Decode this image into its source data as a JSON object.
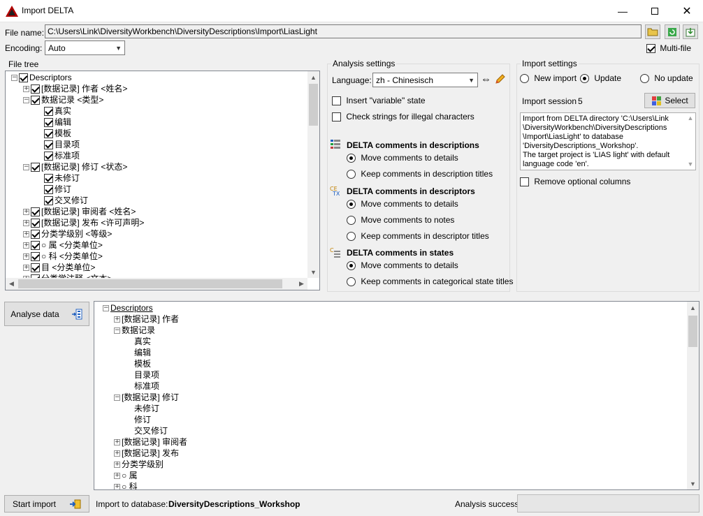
{
  "window": {
    "title": "Import DELTA"
  },
  "file": {
    "label": "File name:",
    "path": "C:\\Users\\Link\\DiversityWorkbench\\DiversityDescriptions\\Import\\LiasLight"
  },
  "encoding": {
    "label": "Encoding:",
    "value": "Auto"
  },
  "multi_file": {
    "label": "Multi-file",
    "checked": true
  },
  "file_tree": {
    "title": "File tree",
    "rows": [
      {
        "indent": 0,
        "exp": "-",
        "checked": true,
        "text": "Descriptors"
      },
      {
        "indent": 1,
        "exp": "+",
        "checked": true,
        "text": "[数据记录] 作者 <姓名>"
      },
      {
        "indent": 1,
        "exp": "-",
        "checked": true,
        "text": "数据记录 <类型>"
      },
      {
        "indent": 2,
        "exp": "",
        "checked": true,
        "text": "真实"
      },
      {
        "indent": 2,
        "exp": "",
        "checked": true,
        "text": "编辑"
      },
      {
        "indent": 2,
        "exp": "",
        "checked": true,
        "text": "模板"
      },
      {
        "indent": 2,
        "exp": "",
        "checked": true,
        "text": "目录项"
      },
      {
        "indent": 2,
        "exp": "",
        "checked": true,
        "text": "标准项"
      },
      {
        "indent": 1,
        "exp": "-",
        "checked": true,
        "text": "[数据记录] 修订 <状态>"
      },
      {
        "indent": 2,
        "exp": "",
        "checked": true,
        "text": "未修订"
      },
      {
        "indent": 2,
        "exp": "",
        "checked": true,
        "text": "修订"
      },
      {
        "indent": 2,
        "exp": "",
        "checked": true,
        "text": "交叉修订"
      },
      {
        "indent": 1,
        "exp": "+",
        "checked": true,
        "text": "[数据记录] 审阅者 <姓名>"
      },
      {
        "indent": 1,
        "exp": "+",
        "checked": true,
        "text": "[数据记录] 发布 <许可声明>"
      },
      {
        "indent": 1,
        "exp": "+",
        "checked": true,
        "text": "分类学级别 <等级>"
      },
      {
        "indent": 1,
        "exp": "+",
        "checked": true,
        "text": "○ 属 <分类单位>"
      },
      {
        "indent": 1,
        "exp": "+",
        "checked": true,
        "text": "○ 科 <分类单位>"
      },
      {
        "indent": 1,
        "exp": "+",
        "checked": true,
        "text": "目 <分类单位>"
      },
      {
        "indent": 1,
        "exp": "+",
        "checked": true,
        "text": "分类学注释 <文本>"
      }
    ]
  },
  "analysis_settings": {
    "title": "Analysis settings",
    "language_label": "Language:",
    "language_value": "zh - Chinesisch",
    "insert_variable": {
      "label": "Insert \"variable\" state",
      "checked": false
    },
    "check_strings": {
      "label": "Check strings for illegal characters",
      "checked": false
    },
    "sections": [
      {
        "heading": "DELTA comments in descriptions",
        "options": [
          {
            "label": "Move comments to details",
            "checked": true
          },
          {
            "label": "Keep comments in description titles",
            "checked": false
          }
        ]
      },
      {
        "heading": "DELTA comments in descriptors",
        "options": [
          {
            "label": "Move comments to details",
            "checked": true
          },
          {
            "label": "Move comments to notes",
            "checked": false
          },
          {
            "label": "Keep comments in descriptor titles",
            "checked": false
          }
        ]
      },
      {
        "heading": "DELTA comments in states",
        "options": [
          {
            "label": "Move comments to details",
            "checked": true
          },
          {
            "label": "Keep comments in categorical state titles",
            "checked": false
          }
        ]
      }
    ]
  },
  "import_settings": {
    "title": "Import settings",
    "modes": [
      {
        "label": "New import",
        "checked": false
      },
      {
        "label": "Update",
        "checked": true
      },
      {
        "label": "No update",
        "checked": false
      }
    ],
    "session_label": "Import session",
    "session_value": "5",
    "select_label": "Select",
    "info_lines": [
      "Import from DELTA directory 'C:\\Users\\Link",
      "\\DiversityWorkbench\\DiversityDescriptions",
      "\\Import\\LiasLight' to database",
      "'DiversityDescriptions_Workshop'.",
      "The target project is 'LIAS light' with default",
      "language code 'en'."
    ],
    "remove_optional": {
      "label": "Remove optional columns",
      "checked": false
    }
  },
  "analyse_button": {
    "label": "Analyse data"
  },
  "result_tree": {
    "rows": [
      {
        "indent": 0,
        "exp": "-",
        "text": "Descriptors",
        "underline": true
      },
      {
        "indent": 1,
        "exp": "+",
        "text": "[数据记录] 作者"
      },
      {
        "indent": 1,
        "exp": "-",
        "text": "数据记录"
      },
      {
        "indent": 2,
        "exp": "",
        "text": "真实"
      },
      {
        "indent": 2,
        "exp": "",
        "text": "编辑"
      },
      {
        "indent": 2,
        "exp": "",
        "text": "模板"
      },
      {
        "indent": 2,
        "exp": "",
        "text": "目录项"
      },
      {
        "indent": 2,
        "exp": "",
        "text": "标准项"
      },
      {
        "indent": 1,
        "exp": "-",
        "text": "[数据记录] 修订"
      },
      {
        "indent": 2,
        "exp": "",
        "text": "未修订"
      },
      {
        "indent": 2,
        "exp": "",
        "text": "修订"
      },
      {
        "indent": 2,
        "exp": "",
        "text": "交叉修订"
      },
      {
        "indent": 1,
        "exp": "+",
        "text": "[数据记录] 审阅者"
      },
      {
        "indent": 1,
        "exp": "+",
        "text": "[数据记录] 发布"
      },
      {
        "indent": 1,
        "exp": "+",
        "text": "分类学级别"
      },
      {
        "indent": 1,
        "exp": "+",
        "text": "○ 属"
      },
      {
        "indent": 1,
        "exp": "+",
        "text": "○ 科"
      }
    ]
  },
  "footer": {
    "start_label": "Start import",
    "import_to_label": "Import to database:",
    "database_name": "DiversityDescriptions_Workshop",
    "analysis_success_label": "Analysis success"
  }
}
